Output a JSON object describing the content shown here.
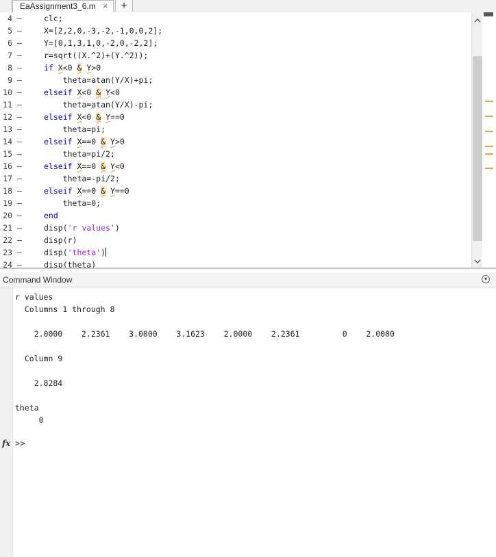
{
  "tabs": {
    "active_label": "EaAssignment3_6.m",
    "close_glyph": "×",
    "add_glyph": "+"
  },
  "editor": {
    "lines": [
      {
        "num": "4",
        "dash": "–"
      },
      {
        "num": "5",
        "dash": "–"
      },
      {
        "num": "6",
        "dash": "–"
      },
      {
        "num": "7",
        "dash": "–"
      },
      {
        "num": "8",
        "dash": "–"
      },
      {
        "num": "9",
        "dash": "–"
      },
      {
        "num": "10",
        "dash": "–"
      },
      {
        "num": "11",
        "dash": "–"
      },
      {
        "num": "12",
        "dash": "–"
      },
      {
        "num": "13",
        "dash": "–"
      },
      {
        "num": "14",
        "dash": "–"
      },
      {
        "num": "15",
        "dash": "–"
      },
      {
        "num": "16",
        "dash": "–"
      },
      {
        "num": "17",
        "dash": "–"
      },
      {
        "num": "18",
        "dash": "–"
      },
      {
        "num": "19",
        "dash": "–"
      },
      {
        "num": "20",
        "dash": "–"
      },
      {
        "num": "21",
        "dash": "–"
      },
      {
        "num": "22",
        "dash": "–"
      },
      {
        "num": "23",
        "dash": "–"
      },
      {
        "num": "24",
        "dash": "–"
      }
    ],
    "code": {
      "l4": "clc;",
      "l5": "X=[2,2,0,-3,-2,-1,0,0,2];",
      "l6": "Y=[0,1,3,1,0,-2,0,-2,2];",
      "l7": "r=sqrt((X.^2)+(Y.^2));",
      "l8_kw": "if",
      "l8_a": " ",
      "l8_x": "X",
      "l8_b": "<0 ",
      "l8_amp": "&",
      "l8_c": " ",
      "l8_y": "Y",
      "l8_d": ">0",
      "l9": "    theta=atan(Y/X)+pi;",
      "l10_kw": "elseif",
      "l10_x": "X",
      "l10_b": "<0 ",
      "l10_amp": "&",
      "l10_y": "Y",
      "l10_d": "<0",
      "l11": "    theta=atan(Y/X)-pi;",
      "l12_kw": "elseif",
      "l12_x": "X",
      "l12_b": "<0 ",
      "l12_amp": "&",
      "l12_y": "Y",
      "l12_d": "==0",
      "l13": "    theta=pi;",
      "l14_kw": "elseif",
      "l14_x": "X",
      "l14_b": "==0 ",
      "l14_amp": "&",
      "l14_y": "Y",
      "l14_d": ">0",
      "l15": "    theta=pi/2;",
      "l16_kw": "elseif",
      "l16_x": "X",
      "l16_b": "==0 ",
      "l16_amp": "&",
      "l16_y": "Y",
      "l16_d": "<0",
      "l17": "    theta=-pi/2;",
      "l18_kw": "elseif",
      "l18_x": "X",
      "l18_b": "==0 ",
      "l18_amp": "&",
      "l18_y": "Y",
      "l18_d": "==0",
      "l19": "    theta=0;",
      "l20_kw": "end",
      "l21_a": "disp(",
      "l21_str": "'r values'",
      "l21_b": ")",
      "l22": "disp(r)",
      "l23_a": "disp(",
      "l23_str": "'theta'",
      "l23_b": ")",
      "l24": "disp(theta)"
    }
  },
  "command_window": {
    "title": "Command Window",
    "menu_glyph": "▾",
    "output": {
      "r_values_label": "r values",
      "columns_1_8": "  Columns 1 through 8",
      "row1": "    2.0000    2.2361    3.0000    3.1623    2.0000    2.2361         0    2.0000",
      "column_9": "  Column 9",
      "row2": "    2.8284",
      "theta_label": "theta",
      "theta_value": "     0"
    },
    "fx_label": "fx",
    "prompt": ">>"
  },
  "colors": {
    "keyword": "#0000ff",
    "string": "#a020f0",
    "warning": "#f3a33b"
  }
}
